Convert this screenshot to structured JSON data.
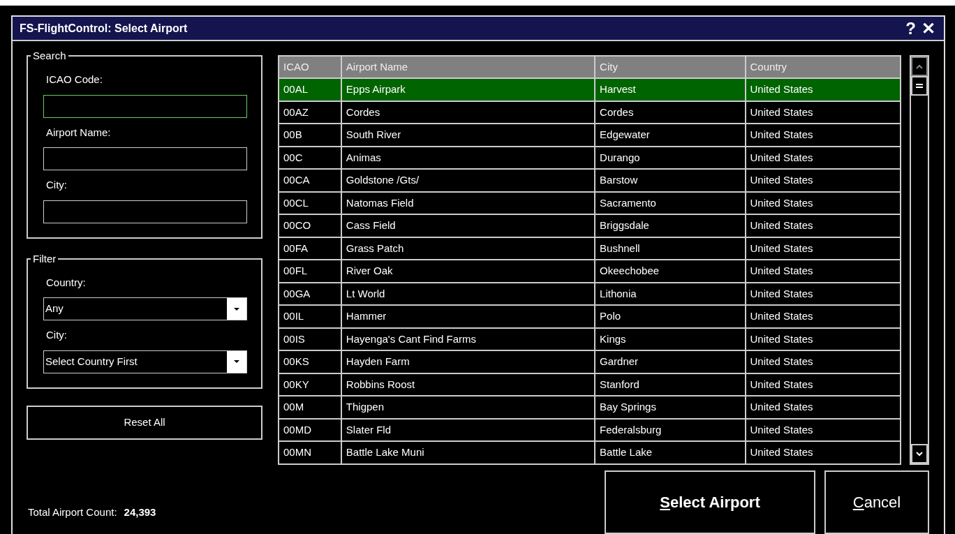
{
  "window": {
    "title": "FS-FlightControl: Select Airport",
    "help": "?",
    "close": "✕"
  },
  "search": {
    "legend": "Search",
    "fields": [
      {
        "label": "ICAO Code:",
        "focused": true
      },
      {
        "label": "Airport Name:",
        "focused": false
      },
      {
        "label": "City:",
        "focused": false
      }
    ]
  },
  "filter": {
    "legend": "Filter",
    "dropdowns": [
      {
        "label": "Country:",
        "value": "Any"
      },
      {
        "label": "City:",
        "value": "Select Country First"
      }
    ]
  },
  "reset_button": "Reset All",
  "total": {
    "label": "Total Airport Count:",
    "value": "24,393"
  },
  "table": {
    "columns": [
      "ICAO",
      "Airport Name",
      "City",
      "Country"
    ],
    "rows": [
      {
        "cells": [
          "00AL",
          "Epps Airpark",
          "Harvest",
          "United States"
        ],
        "selected": true
      },
      {
        "cells": [
          "00AZ",
          "Cordes",
          "Cordes",
          "United States"
        ],
        "selected": false
      },
      {
        "cells": [
          "00B",
          "South River",
          "Edgewater",
          "United States"
        ],
        "selected": false
      },
      {
        "cells": [
          "00C",
          "Animas",
          "Durango",
          "United States"
        ],
        "selected": false
      },
      {
        "cells": [
          "00CA",
          "Goldstone /Gts/",
          "Barstow",
          "United States"
        ],
        "selected": false
      },
      {
        "cells": [
          "00CL",
          "Natomas Field",
          "Sacramento",
          "United States"
        ],
        "selected": false
      },
      {
        "cells": [
          "00CO",
          "Cass Field",
          "Briggsdale",
          "United States"
        ],
        "selected": false
      },
      {
        "cells": [
          "00FA",
          "Grass Patch",
          "Bushnell",
          "United States"
        ],
        "selected": false
      },
      {
        "cells": [
          "00FL",
          "River Oak",
          "Okeechobee",
          "United States"
        ],
        "selected": false
      },
      {
        "cells": [
          "00GA",
          "Lt World",
          "Lithonia",
          "United States"
        ],
        "selected": false
      },
      {
        "cells": [
          "00IL",
          "Hammer",
          "Polo",
          "United States"
        ],
        "selected": false
      },
      {
        "cells": [
          "00IS",
          "Hayenga's Cant Find Farms",
          "Kings",
          "United States"
        ],
        "selected": false
      },
      {
        "cells": [
          "00KS",
          "Hayden Farm",
          "Gardner",
          "United States"
        ],
        "selected": false
      },
      {
        "cells": [
          "00KY",
          "Robbins Roost",
          "Stanford",
          "United States"
        ],
        "selected": false
      },
      {
        "cells": [
          "00M",
          "Thigpen",
          "Bay Springs",
          "United States"
        ],
        "selected": false
      },
      {
        "cells": [
          "00MD",
          "Slater Fld",
          "Federalsburg",
          "United States"
        ],
        "selected": false
      },
      {
        "cells": [
          "00MN",
          "Battle Lake Muni",
          "Battle Lake",
          "United States"
        ],
        "selected": false
      }
    ]
  },
  "buttons": [
    {
      "label": "**S**elect Airport",
      "kind": "primary"
    },
    {
      "label": "**C**ancel",
      "kind": "secondary"
    }
  ]
}
